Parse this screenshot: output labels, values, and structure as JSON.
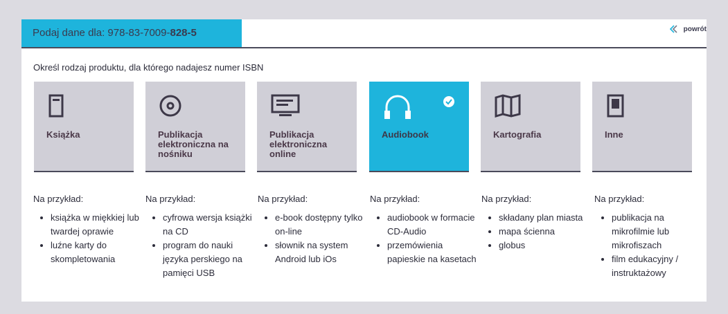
{
  "header": {
    "isbn_prefix": "Podaj dane dla: 978-83-7009-",
    "isbn_bold": "828-5",
    "back_label": "powrót"
  },
  "instruction": "Określ rodzaj produktu, dla którego nadajesz numer ISBN",
  "accent_color": "#1eb4dc",
  "products": [
    {
      "label": "Książka",
      "icon": "book-icon",
      "selected": false,
      "examples_title": "Na przykład:",
      "examples": [
        "książka w miękkiej lub twardej oprawie",
        "luźne karty do skompletowania"
      ]
    },
    {
      "label": "Publikacja elektroniczna na nośniku",
      "icon": "disc-icon",
      "selected": false,
      "examples_title": "Na przykład:",
      "examples": [
        "cyfrowa wersja książki na CD",
        "program do nauki języka perskiego na pamięci USB"
      ]
    },
    {
      "label": "Publikacja elektroniczna online",
      "icon": "monitor-icon",
      "selected": false,
      "examples_title": "Na przykład:",
      "examples": [
        "e-book dostępny tylko on-line",
        "słownik na system Android lub iOs"
      ]
    },
    {
      "label": "Audiobook",
      "icon": "headphones-icon",
      "selected": true,
      "examples_title": "Na przykład:",
      "examples": [
        "audiobook w formacie CD-Audio",
        "przemówienia papieskie na kasetach"
      ]
    },
    {
      "label": "Kartografia",
      "icon": "map-icon",
      "selected": false,
      "examples_title": "Na przykład:",
      "examples": [
        "składany plan miasta",
        "mapa ścienna",
        "globus"
      ]
    },
    {
      "label": "Inne",
      "icon": "microfilm-icon",
      "selected": false,
      "examples_title": "Na przykład:",
      "examples": [
        "publikacja na mikrofilmie lub mikrofiszach",
        "film edukacyjny / instruktażowy"
      ]
    }
  ]
}
